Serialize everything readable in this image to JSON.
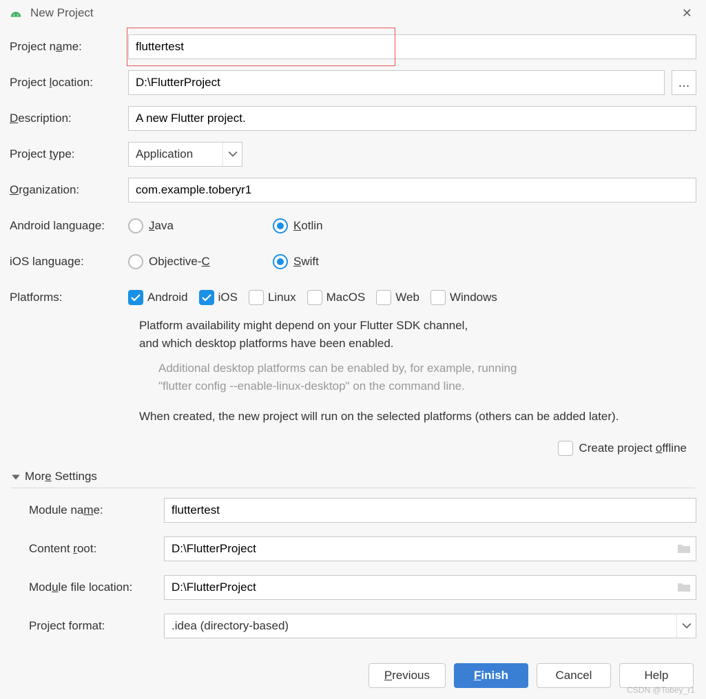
{
  "window": {
    "title": "New Project"
  },
  "fields": {
    "project_name": {
      "label": "Project name:",
      "value": "fluttertest"
    },
    "project_location": {
      "label": "Project location:",
      "value": "D:\\FlutterProject",
      "browse": "..."
    },
    "description": {
      "label": "Description:",
      "value": "A new Flutter project."
    },
    "project_type": {
      "label": "Project type:",
      "value": "Application"
    },
    "organization": {
      "label": "Organization:",
      "value": "com.example.toberyr1"
    },
    "android_language": {
      "label": "Android language:",
      "options": {
        "java": "Java",
        "kotlin": "Kotlin"
      },
      "selected": "kotlin"
    },
    "ios_language": {
      "label": "iOS language:",
      "options": {
        "objc": "Objective-C",
        "swift": "Swift"
      },
      "selected": "swift"
    },
    "platforms": {
      "label": "Platforms:",
      "items": [
        {
          "key": "android",
          "label": "Android",
          "checked": true
        },
        {
          "key": "ios",
          "label": "iOS",
          "checked": true
        },
        {
          "key": "linux",
          "label": "Linux",
          "checked": false
        },
        {
          "key": "macos",
          "label": "MacOS",
          "checked": false
        },
        {
          "key": "web",
          "label": "Web",
          "checked": false
        },
        {
          "key": "windows",
          "label": "Windows",
          "checked": false
        }
      ]
    }
  },
  "info": {
    "line1": "Platform availability might depend on your Flutter SDK channel,",
    "line2": "and which desktop platforms have been enabled.",
    "hint1": "Additional desktop platforms can be enabled by, for example, running",
    "hint2": "\"flutter config --enable-linux-desktop\" on the command line.",
    "line3": "When created, the new project will run on the selected platforms (others can be added later)."
  },
  "offline": {
    "label": "Create project offline",
    "checked": false
  },
  "more": {
    "title": "More Settings",
    "module_name": {
      "label": "Module name:",
      "value": "fluttertest"
    },
    "content_root": {
      "label": "Content root:",
      "value": "D:\\FlutterProject"
    },
    "module_file_location": {
      "label": "Module file location:",
      "value": "D:\\FlutterProject"
    },
    "project_format": {
      "label": "Project format:",
      "value": ".idea (directory-based)"
    }
  },
  "buttons": {
    "previous": "Previous",
    "finish": "Finish",
    "cancel": "Cancel",
    "help": "Help"
  },
  "watermark": "CSDN @Tobey_r1"
}
